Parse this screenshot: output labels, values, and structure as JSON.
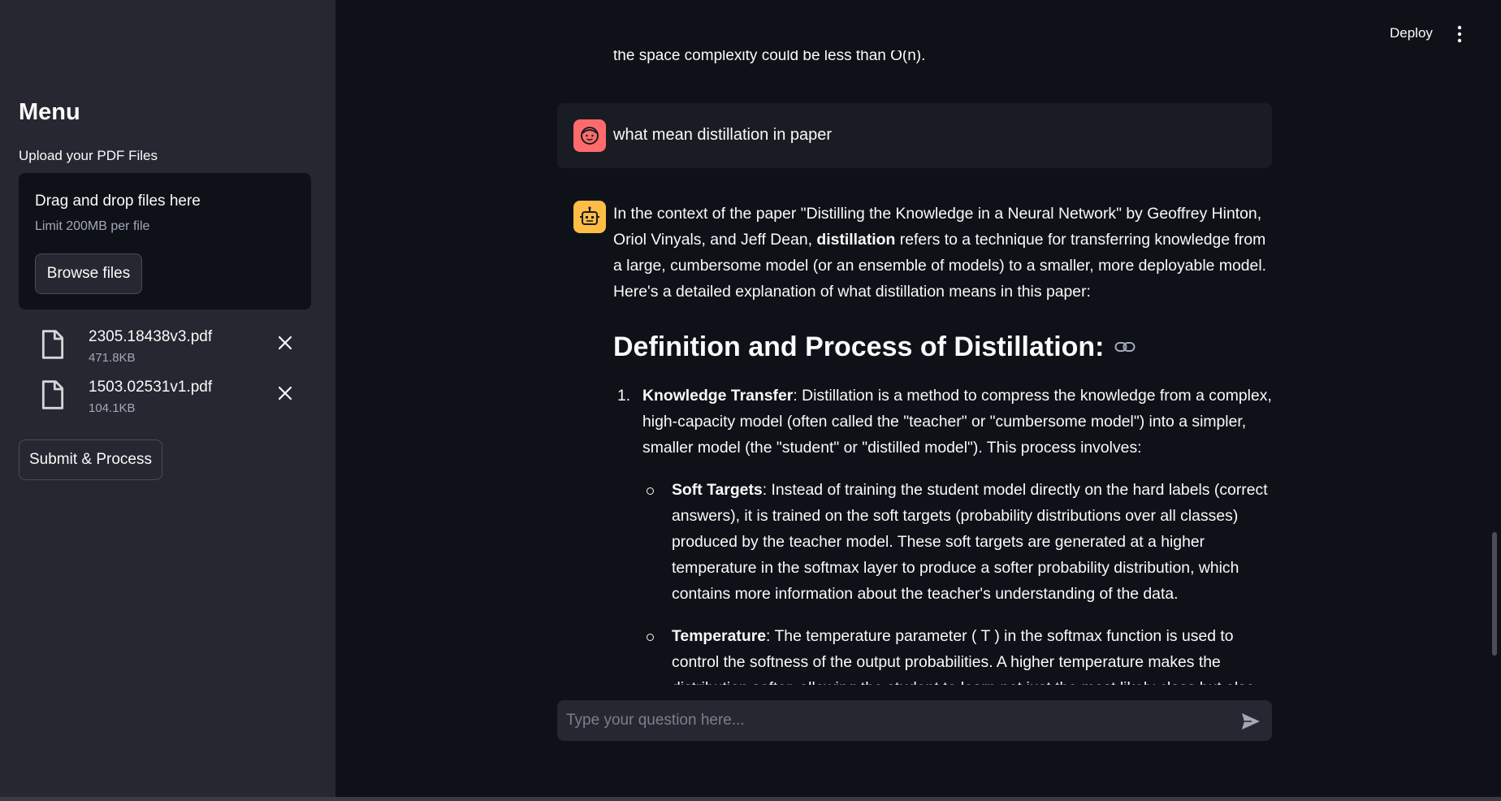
{
  "sidebar": {
    "title": "Menu",
    "upload_label": "Upload your PDF Files",
    "dropzone": {
      "title": "Drag and drop files here",
      "limit": "Limit 200MB per file",
      "browse_label": "Browse files"
    },
    "files": [
      {
        "name": "2305.18438v3.pdf",
        "size": "471.8KB"
      },
      {
        "name": "1503.02531v1.pdf",
        "size": "104.1KB"
      }
    ],
    "submit_label": "Submit & Process"
  },
  "header": {
    "deploy_label": "Deploy",
    "menu_icon": "kebab-menu-icon"
  },
  "chat": {
    "previous_tail": "the space complexity could be less than O(n).",
    "user_message": "what mean distillation in paper",
    "answer": {
      "intro_1": "In the context of the paper \"Distilling the Knowledge in a Neural Network\" by Geoffrey Hinton, Oriol Vinyals, and Jeff Dean, ",
      "intro_bold": "distillation",
      "intro_2": " refers to a technique for transferring knowledge from a large, cumbersome model (or an ensemble of models) to a smaller, more deployable model. Here's a detailed explanation of what distillation means in this paper:",
      "heading": "Definition and Process of Distillation:",
      "item1_num": "1.",
      "item1_bold": "Knowledge Transfer",
      "item1_text": ": Distillation is a method to compress the knowledge from a complex, high-capacity model (often called the \"teacher\" or \"cumbersome model\") into a simpler, smaller model (the \"student\" or \"distilled model\"). This process involves:",
      "sub1_bold": "Soft Targets",
      "sub1_text": ": Instead of training the student model directly on the hard labels (correct answers), it is trained on the soft targets (probability distributions over all classes) produced by the teacher model. These soft targets are generated at a higher temperature in the softmax layer to produce a softer probability distribution, which contains more information about the teacher's understanding of the data.",
      "sub2_bold": "Temperature",
      "sub2_text": ": The temperature parameter ( T ) in the softmax function is used to control the softness of the output probabilities. A higher temperature makes the distribution softer, allowing the student to learn not just the most likely class but also the relative"
    }
  },
  "input": {
    "placeholder": "Type your question here..."
  },
  "colors": {
    "sidebar_bg": "#262730",
    "main_bg": "#0e1117",
    "user_avatar": "#ff6b6b",
    "bot_avatar": "#ffbd45"
  }
}
